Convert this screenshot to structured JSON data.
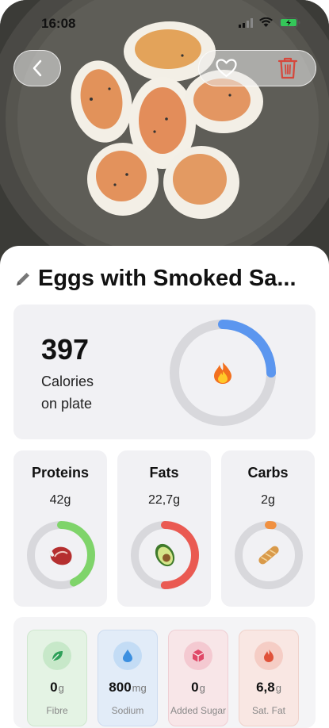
{
  "status_bar": {
    "time": "16:08",
    "battery_color": "#34c759"
  },
  "header": {
    "back_icon": "chevron-left-icon",
    "favorite_icon": "heart-icon",
    "delete_icon": "trash-icon",
    "delete_color": "#d6473b"
  },
  "meal": {
    "title": "Eggs with Smoked Sa..."
  },
  "calories": {
    "value": "397",
    "label_line1": "Calories",
    "label_line2": "on plate",
    "progress": 0.25,
    "icon": "fire-icon",
    "ring_color": "#5b96ef"
  },
  "macros": [
    {
      "name": "Proteins",
      "value": "42g",
      "progress": 0.43,
      "color": "#7fd46a",
      "icon": "meat-icon"
    },
    {
      "name": "Fats",
      "value": "22,7g",
      "progress": 0.5,
      "color": "#ea5a52",
      "icon": "avocado-icon"
    },
    {
      "name": "Carbs",
      "value": "2g",
      "progress": 0.02,
      "color": "#f09040",
      "icon": "bread-icon"
    }
  ],
  "micros": [
    {
      "label": "Fibre",
      "value": "0",
      "unit": "g",
      "icon": "leaf-icon",
      "color": "#2fa05a"
    },
    {
      "label": "Sodium",
      "value": "800",
      "unit": "mg",
      "icon": "drop-icon",
      "color": "#3b8fe0"
    },
    {
      "label": "Added Sugar",
      "value": "0",
      "unit": "g",
      "icon": "cube-icon",
      "color": "#e04868"
    },
    {
      "label": "Sat. Fat",
      "value": "6,8",
      "unit": "g",
      "icon": "flame-icon",
      "color": "#e0523a"
    }
  ]
}
